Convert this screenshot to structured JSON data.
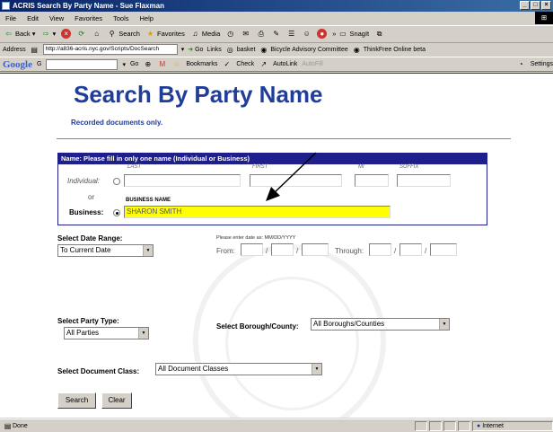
{
  "window": {
    "title": "ACRIS Search By Party Name - Sue Flaxman"
  },
  "menu": [
    "File",
    "Edit",
    "View",
    "Favorites",
    "Tools",
    "Help"
  ],
  "toolbar": {
    "back": "Back",
    "search": "Search",
    "favorites": "Favorites",
    "media": "Media",
    "snagit": "SnagIt"
  },
  "address": {
    "label": "Address",
    "url": "http://a836-acris.nyc.gov/Scripts/DocSearch",
    "go": "Go",
    "links": "Links",
    "link_items": [
      "basket",
      "Bicycle Advisory Committee",
      "ThinkFree Online beta"
    ]
  },
  "google": {
    "logo": "Google",
    "g_menu": "G",
    "go": "Go",
    "bookmarks": "Bookmarks",
    "check": "Check",
    "autolink": "AutoLink",
    "autofill": "AutoFill",
    "settings": "Settings"
  },
  "page": {
    "title": "Search By Party Name",
    "subtitle": "Recorded documents only."
  },
  "name_section": {
    "header": "Name:     Please fill in only one name (Individual or Business)",
    "col_last": "LAST",
    "col_first": "FIRST",
    "col_mi": "MI",
    "col_suffix": "SUFFIX",
    "individual_label": "Individual:",
    "or_label": "or",
    "business_name_label": "BUSINESS NAME",
    "business_label": "Business:",
    "business_value": "SHARON SMITH",
    "highlight_color": "#ffff00"
  },
  "date_range": {
    "label": "Select Date Range:",
    "selected": "To Current Date",
    "hint": "Please enter date as: MM/DD/YYYY",
    "from_label": "From:",
    "through_label": "Through:"
  },
  "party_type": {
    "label": "Select Party Type:",
    "selected": "All Parties"
  },
  "borough": {
    "label": "Select Borough/County:",
    "selected": "All Boroughs/Counties"
  },
  "doc_class": {
    "label": "Select Document Class:",
    "selected": "All Document Classes"
  },
  "buttons": {
    "search": "Search",
    "clear": "Clear"
  },
  "status": {
    "text": "Done",
    "zone": "Internet"
  }
}
